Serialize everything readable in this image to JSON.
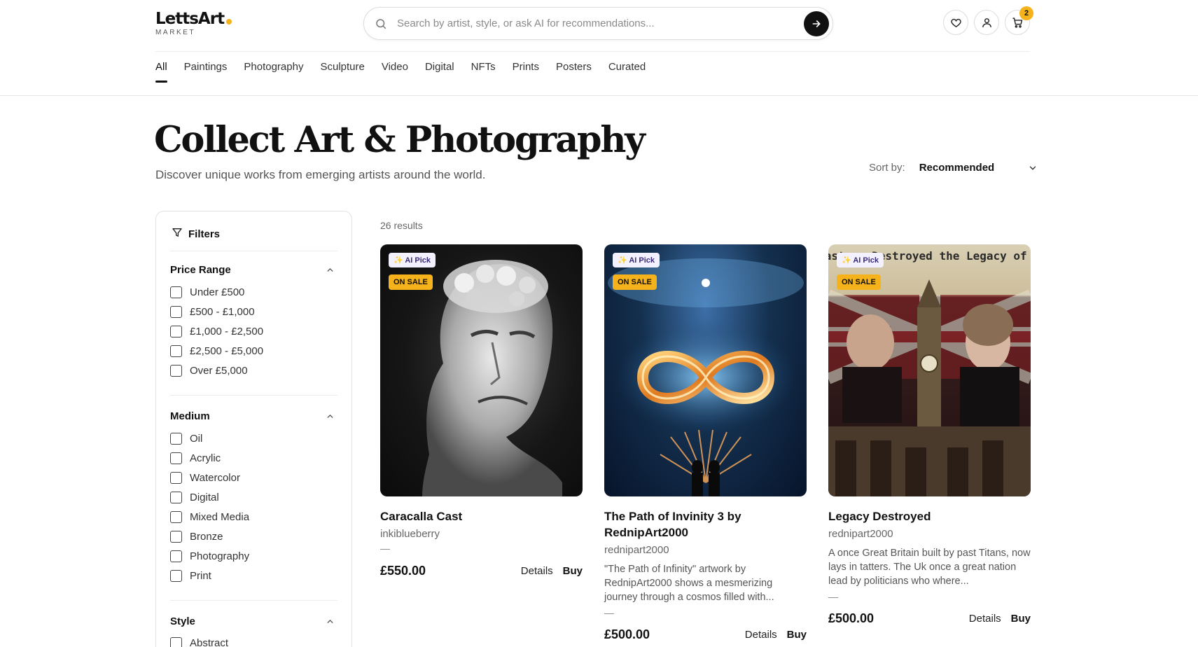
{
  "brand": {
    "name": "LettsArt",
    "sub": "MARKET"
  },
  "search": {
    "placeholder": "Search by artist, style, or ask AI for recommendations..."
  },
  "header": {
    "cart_count": "2"
  },
  "nav": [
    "All",
    "Paintings",
    "Photography",
    "Sculpture",
    "Video",
    "Digital",
    "NFTs",
    "Prints",
    "Posters",
    "Curated"
  ],
  "hero": {
    "title": "Collect Art & Photography",
    "subtitle": "Discover unique works from emerging artists around the world."
  },
  "sort": {
    "label": "Sort by:",
    "value": "Recommended"
  },
  "filters": {
    "title": "Filters",
    "sections": [
      {
        "title": "Price Range",
        "options": [
          "Under £500",
          "£500 - £1,000",
          "£1,000 - £2,500",
          "£2,500 - £5,000",
          "Over £5,000"
        ]
      },
      {
        "title": "Medium",
        "options": [
          "Oil",
          "Acrylic",
          "Watercolor",
          "Digital",
          "Mixed Media",
          "Bronze",
          "Photography",
          "Print"
        ]
      },
      {
        "title": "Style",
        "options": [
          "Abstract"
        ]
      }
    ]
  },
  "results": {
    "count": "26 results",
    "cards": [
      {
        "badge_ai": "✨ AI Pick",
        "badge_sale": "ON SALE",
        "title": "Caracalla Cast",
        "artist": "inkiblueberry",
        "desc": "",
        "dash": "—",
        "price": "£550.00",
        "details": "Details",
        "buy": "Buy"
      },
      {
        "badge_ai": "✨ AI Pick",
        "badge_sale": "ON SALE",
        "title": "The Path of Invinity 3 by RednipArt2000",
        "artist": "rednipart2000",
        "desc": "\"The Path of Infinity\" artwork by RednipArt2000 shows a mesmerizing journey through a cosmos filled with...",
        "dash": "—",
        "price": "£500.00",
        "details": "Details",
        "buy": "Buy"
      },
      {
        "badge_ai": "✨ AI Pick",
        "badge_sale": "ON SALE",
        "title": "Legacy Destroyed",
        "artist": "rednipart2000",
        "desc": "A once Great Britain built by past Titans, now lays in tatters. The Uk once a great nation lead by politicians who where...",
        "dash": "—",
        "price": "£500.00",
        "details": "Details",
        "buy": "Buy",
        "image_text": "'s masters Destroyed the Legacy of Past"
      }
    ]
  }
}
